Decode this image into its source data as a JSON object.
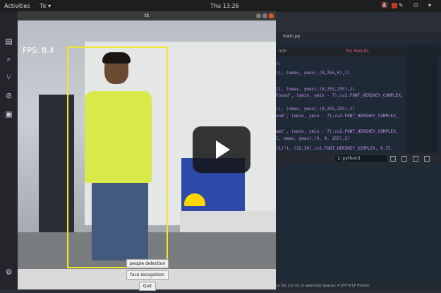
{
  "topbar": {
    "activities": "Activities",
    "app_menu": "Tk ▾",
    "clock": "Thu 13:26",
    "tray": "🔇 ✎ ⏻ ▾"
  },
  "dock": {
    "icons": [
      "files-icon",
      "search-icon",
      "git-icon",
      "debug-icon",
      "extensions-icon",
      "settings-icon"
    ]
  },
  "window": {
    "title": "tk",
    "fps": "FPS: 8.4"
  },
  "video": {
    "play_icon": "play-icon"
  },
  "buttons": {
    "people": "people detection",
    "face": "face recognition",
    "quit": "Quit"
  },
  "editor": {
    "tab": "main.py",
    "find": "ieth",
    "no_results": "No Results",
    "code": [
      "r:",
      "l), (xmax, ymax),(0,255,0),2)",
      "l), (xmax, ymax),(0,255,255),2)",
      "Found', (xmin, ymin - 7),cv2.FONT_HERSHEY_COMPLEX,",
      "l), (xmax, ymax),(0,255,255),2)",
      "und', (xmin, ymin - 7),cv2.FONT_HERSHEY_COMPLEX,",
      "met', (xmin, ymin - 7),cv2.FONT_HERSHEY_COMPLEX,",
      "l, xmax, ymax),(0, 0, 255),2)",
      "(1)\"), (15,30),cv2.FONT_HERSHEY_SIMPLEX, 0.75,"
    ],
    "panel_select": "1: python3",
    "status": "Ln 58, Col 31 (5 selected)   Spaces: 4   UTF-8   LF   Python"
  }
}
